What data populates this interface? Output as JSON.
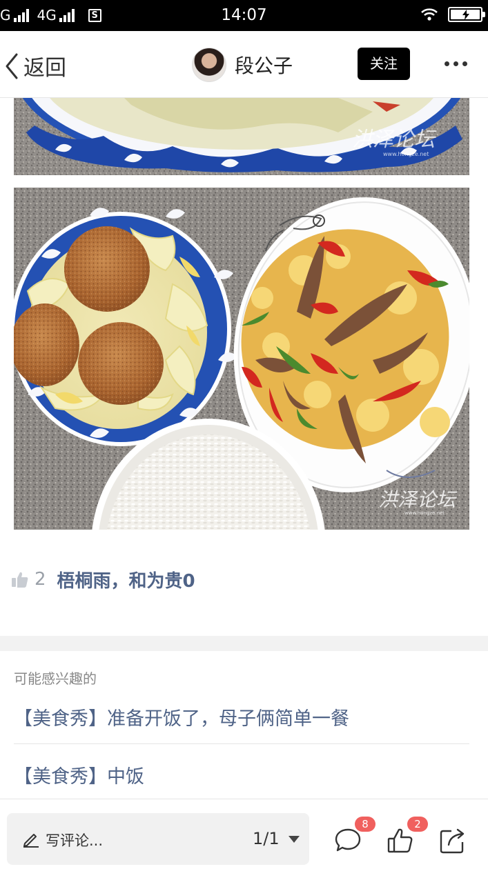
{
  "status_bar": {
    "network_left": "G",
    "network_4g": "4G",
    "sim_label": "S",
    "time": "14:07"
  },
  "nav": {
    "back_label": "返回",
    "author_name": "段公子",
    "follow_label": "关注"
  },
  "post": {
    "photos": [
      "tomato-egg-cabbage-soup-plate",
      "meatball-cabbage-soup-fish-stirfry-rice"
    ],
    "watermark_text": "洪泽论坛",
    "watermark_url": "www.hongze.net"
  },
  "likes": {
    "count": "2",
    "likers": "梧桐雨，和为贵0"
  },
  "related": {
    "heading": "可能感兴趣的",
    "items": [
      "【美食秀】准备开饭了，母子俩简单一餐",
      "【美食秀】中饭"
    ]
  },
  "bottom_bar": {
    "comment_placeholder": "写评论...",
    "page_indicator": "1/1",
    "comment_badge": "8",
    "like_badge": "2"
  },
  "colors": {
    "link": "#4f6387",
    "badge": "#f0605e",
    "follow_bg": "#000000"
  }
}
